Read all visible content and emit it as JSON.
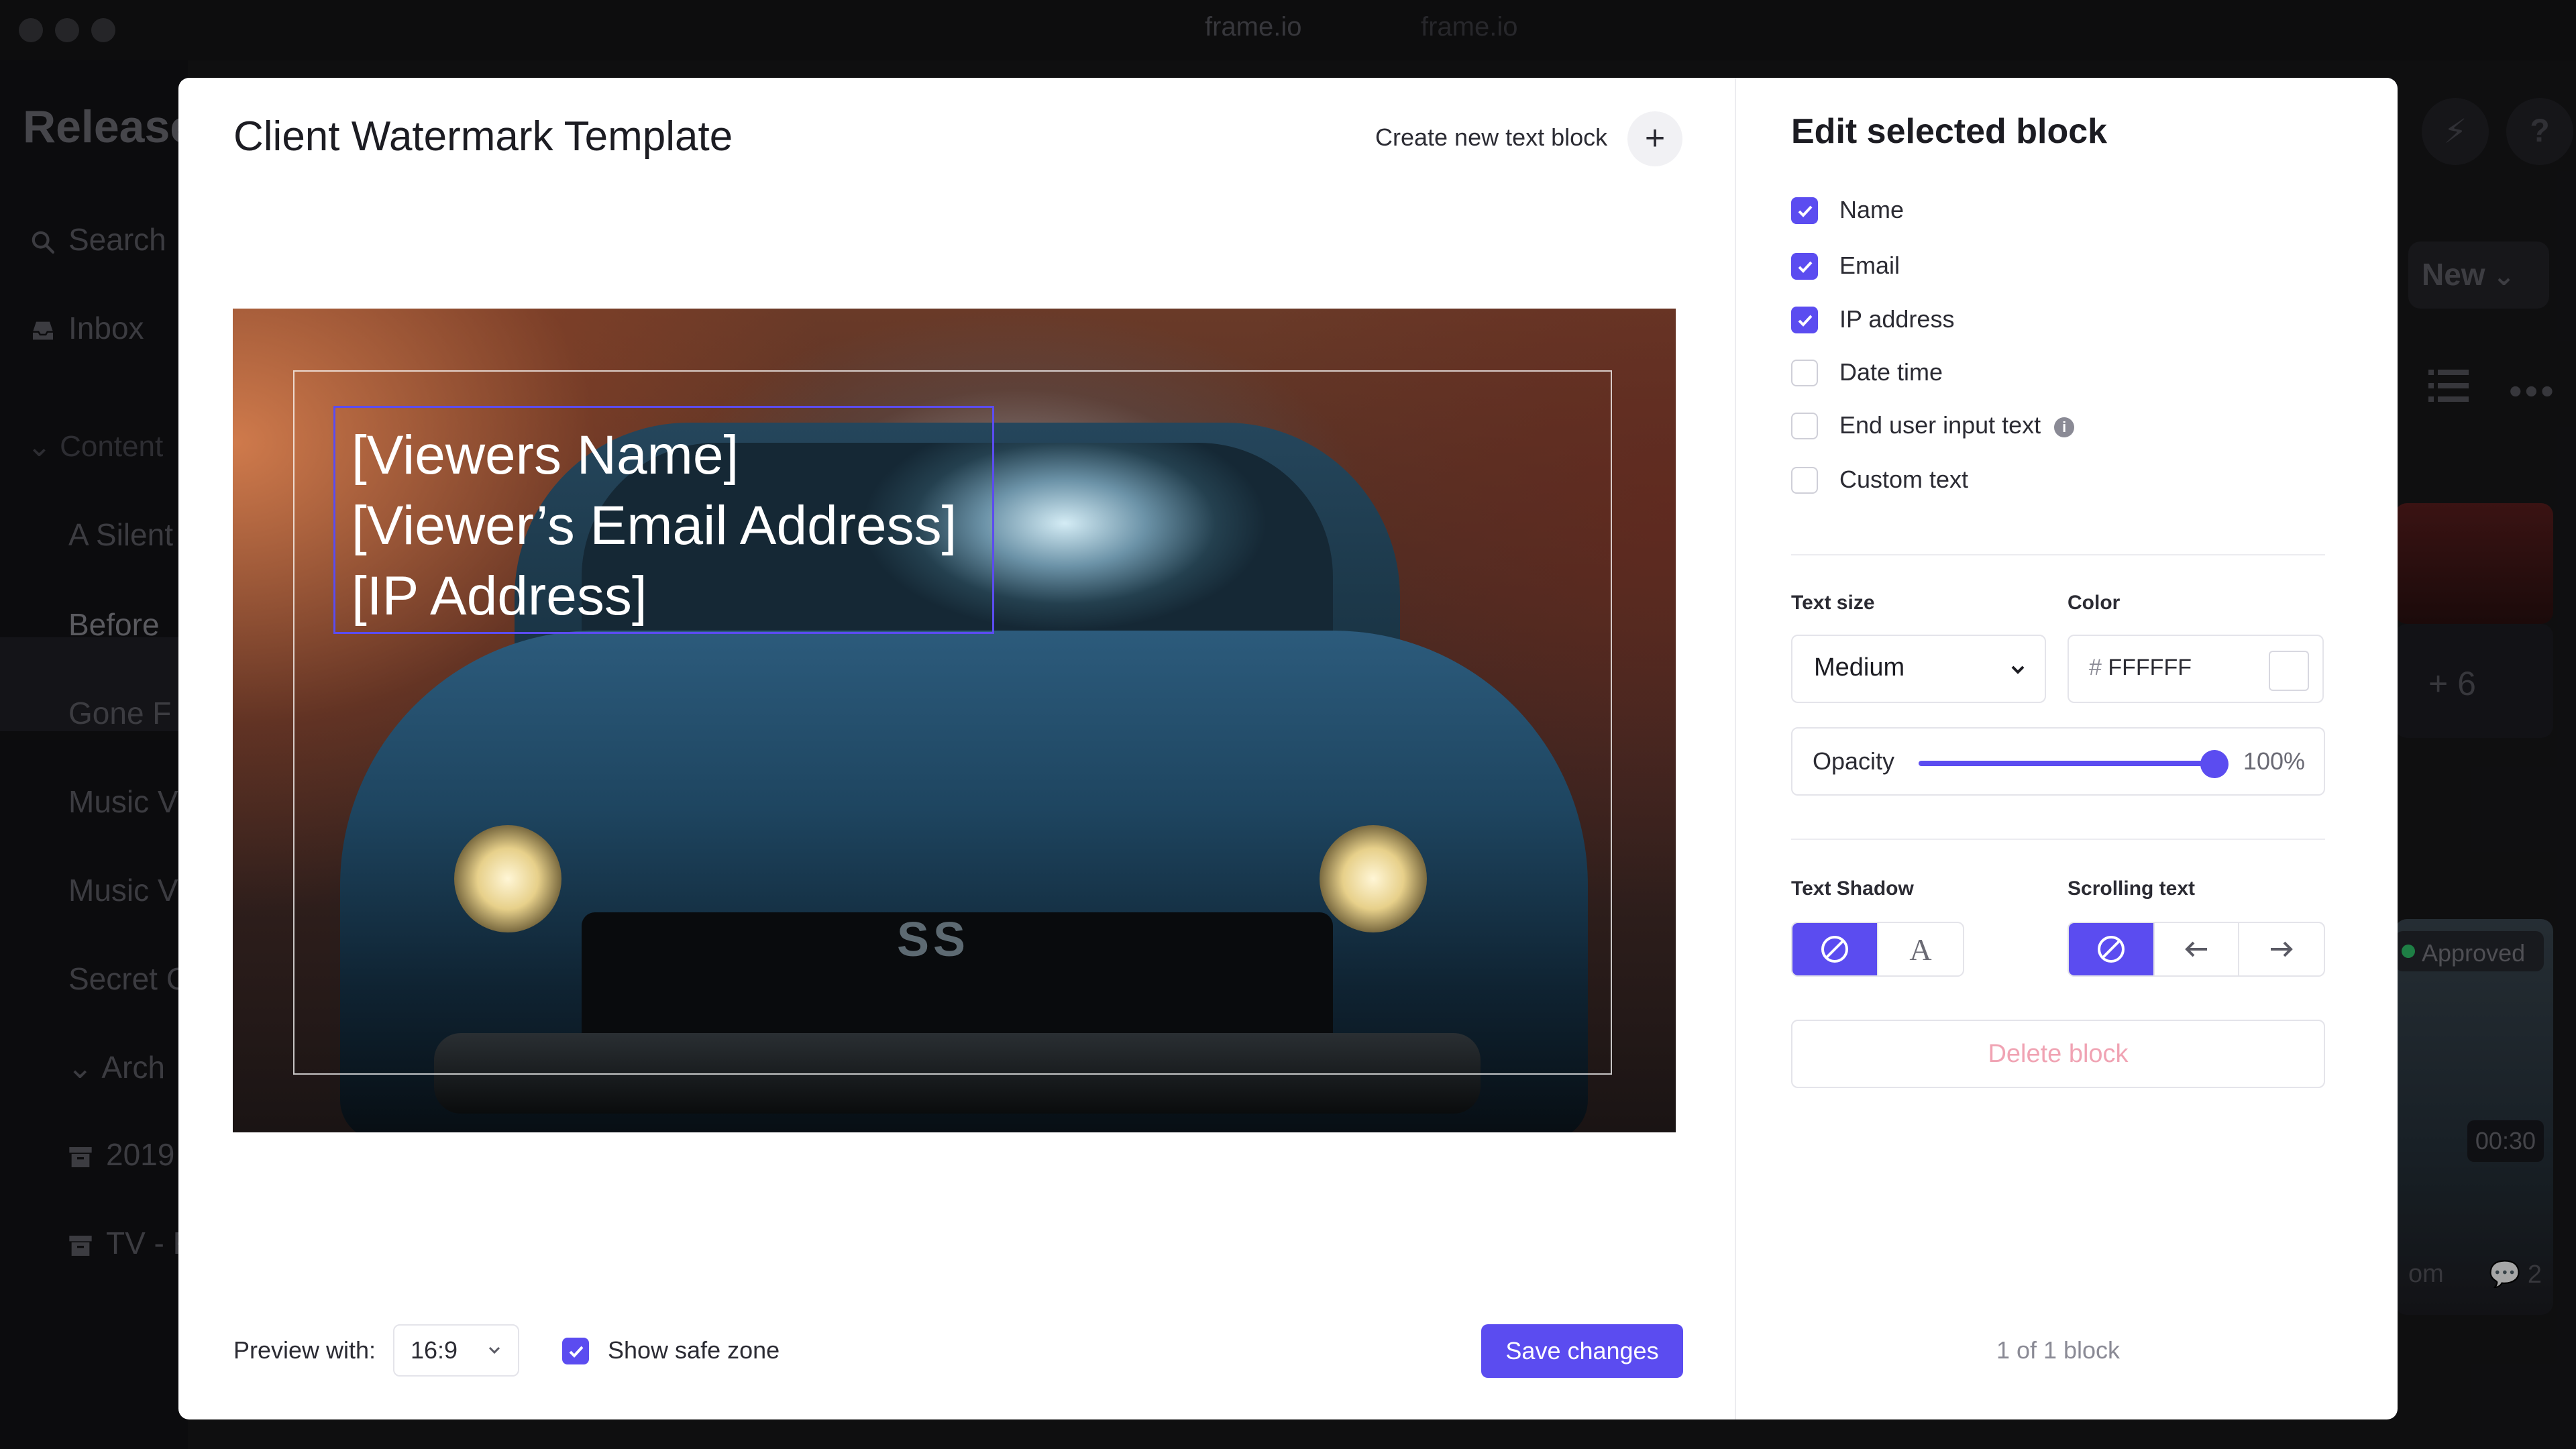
{
  "window": {
    "tabs": [
      "frame.io",
      "frame.io"
    ]
  },
  "background_app": {
    "project_title": "Release",
    "nav": [
      "Search",
      "Inbox"
    ],
    "sections": [
      {
        "label": "Content"
      },
      {
        "label": "A Silent"
      },
      {
        "label": "Before"
      },
      {
        "label": "Gone F"
      },
      {
        "label": "Music V"
      },
      {
        "label": "Music V"
      },
      {
        "label": "Secret C"
      },
      {
        "label": "Arch"
      },
      {
        "label": "2019"
      },
      {
        "label": "TV - F"
      }
    ],
    "new_button": "New",
    "count_badge": "+ 6",
    "status_badge": "Approved",
    "duration": "00:30",
    "comment_count": "2",
    "partial_text": "om"
  },
  "modal": {
    "title": "Client Watermark Template",
    "create_block_label": "Create new text block",
    "preview": {
      "watermark_lines": [
        "[Viewers Name]",
        "[Viewer’s Email Address]",
        "[IP Address]"
      ],
      "badge_text": "SS"
    },
    "footer": {
      "preview_with_label": "Preview with:",
      "ratio_value": "16:9",
      "show_safe_zone_label": "Show safe zone",
      "show_safe_zone_checked": true,
      "save_label": "Save changes"
    },
    "editor": {
      "title": "Edit selected block",
      "fields": [
        {
          "label": "Name",
          "checked": true
        },
        {
          "label": "Email",
          "checked": true
        },
        {
          "label": "IP address",
          "checked": true
        },
        {
          "label": "Date time",
          "checked": false
        },
        {
          "label": "End user input text",
          "checked": false,
          "info": "i"
        },
        {
          "label": "Custom text",
          "checked": false
        }
      ],
      "text_size_label": "Text size",
      "text_size_value": "Medium",
      "color_label": "Color",
      "color_hash": "#",
      "color_value": "FFFFFF",
      "opacity_label": "Opacity",
      "opacity_value": "100%",
      "opacity_fraction": 1.0,
      "text_shadow_label": "Text Shadow",
      "text_shadow_options": [
        "none-icon",
        "A"
      ],
      "scrolling_text_label": "Scrolling text",
      "scrolling_text_options": [
        "none-icon",
        "arrow-left-icon",
        "arrow-right-icon"
      ],
      "delete_label": "Delete block",
      "block_count": "1 of 1 block"
    }
  },
  "colors": {
    "accent": "#5B4CF0",
    "delete_text": "#F0A3B3",
    "approved_dot": "#2FC46A"
  }
}
